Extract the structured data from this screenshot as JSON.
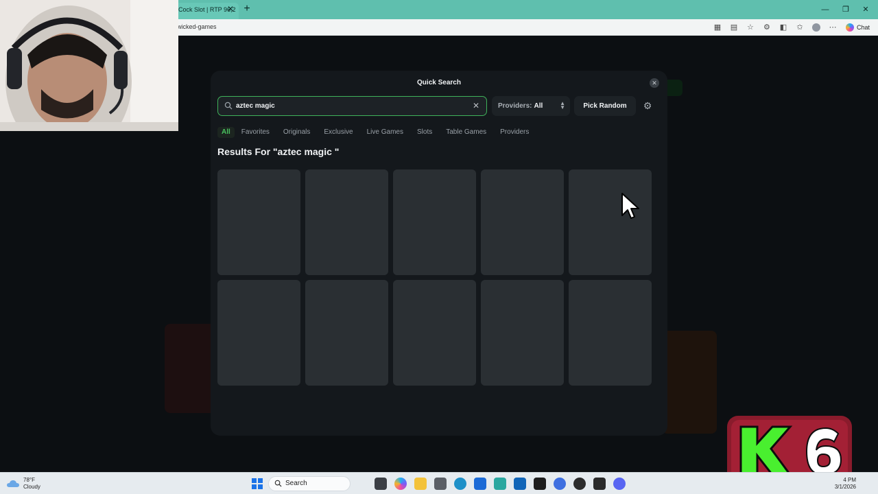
{
  "browser": {
    "tab_title": "Cock Slot | RTP 96,2",
    "tab_close": "✕",
    "new_tab": "+",
    "url": "wicked-games",
    "chat_label": "Chat",
    "window_controls": {
      "minimize": "—",
      "restore": "❐",
      "close": "✕"
    }
  },
  "modal": {
    "title": "Quick Search",
    "close_icon": "close-icon",
    "search": {
      "value": "aztec magic"
    },
    "providers": {
      "label": "Providers:",
      "value": "All"
    },
    "pick_random_label": "Pick Random",
    "categories": [
      "All",
      "Favorites",
      "Originals",
      "Exclusive",
      "Live Games",
      "Slots",
      "Table Games",
      "Providers"
    ],
    "active_category": "All",
    "results_title": "Results For \"aztec magic \"",
    "result_count_placeholders": 10
  },
  "taskbar": {
    "weather_temp": "78°F",
    "weather_desc": "Cloudy",
    "search_label": "Search",
    "time": "4 PM",
    "date": "3/1/2026"
  },
  "overlay": {
    "logo_text": "K 6"
  },
  "colors": {
    "accent_green": "#49c45f",
    "modal_bg": "#14181c",
    "card_bg": "#2a2f33",
    "browser_teal": "#5fbfae"
  }
}
